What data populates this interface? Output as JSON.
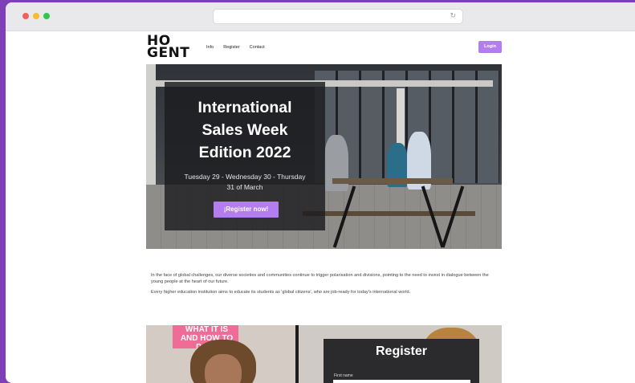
{
  "browser": {
    "url": "",
    "reload_icon": "reload-icon"
  },
  "nav": {
    "logo_line1": "HO",
    "logo_line2": "GENT",
    "links": [
      "Info",
      "Register",
      "Contact"
    ],
    "login_label": "Login"
  },
  "hero": {
    "title_line1": "International",
    "title_line2": "Sales Week",
    "title_line3": "Edition 2022",
    "date_line1": "Tuesday 29 - Wednesday 30 - Thursday",
    "date_line2": "31 of March",
    "cta_label": "¡Register now!"
  },
  "intro": {
    "paragraph1": "In the face of global challenges, our diverse societies and communities continue to trigger polarisation and divisions, pointing to the need to invest in dialogue between the young people at the heart of our future.",
    "paragraph2": "Every higher education institution aims to educate its students as 'global citizens', who are job-ready for today's international world."
  },
  "register_section": {
    "poster_text": "WHAT IT IS AND HOW TO DO IT",
    "title": "Register",
    "first_name_label": "First name",
    "first_name_value": ""
  },
  "colors": {
    "accent": "#b37cf0",
    "frame": "#7e3fb8"
  }
}
